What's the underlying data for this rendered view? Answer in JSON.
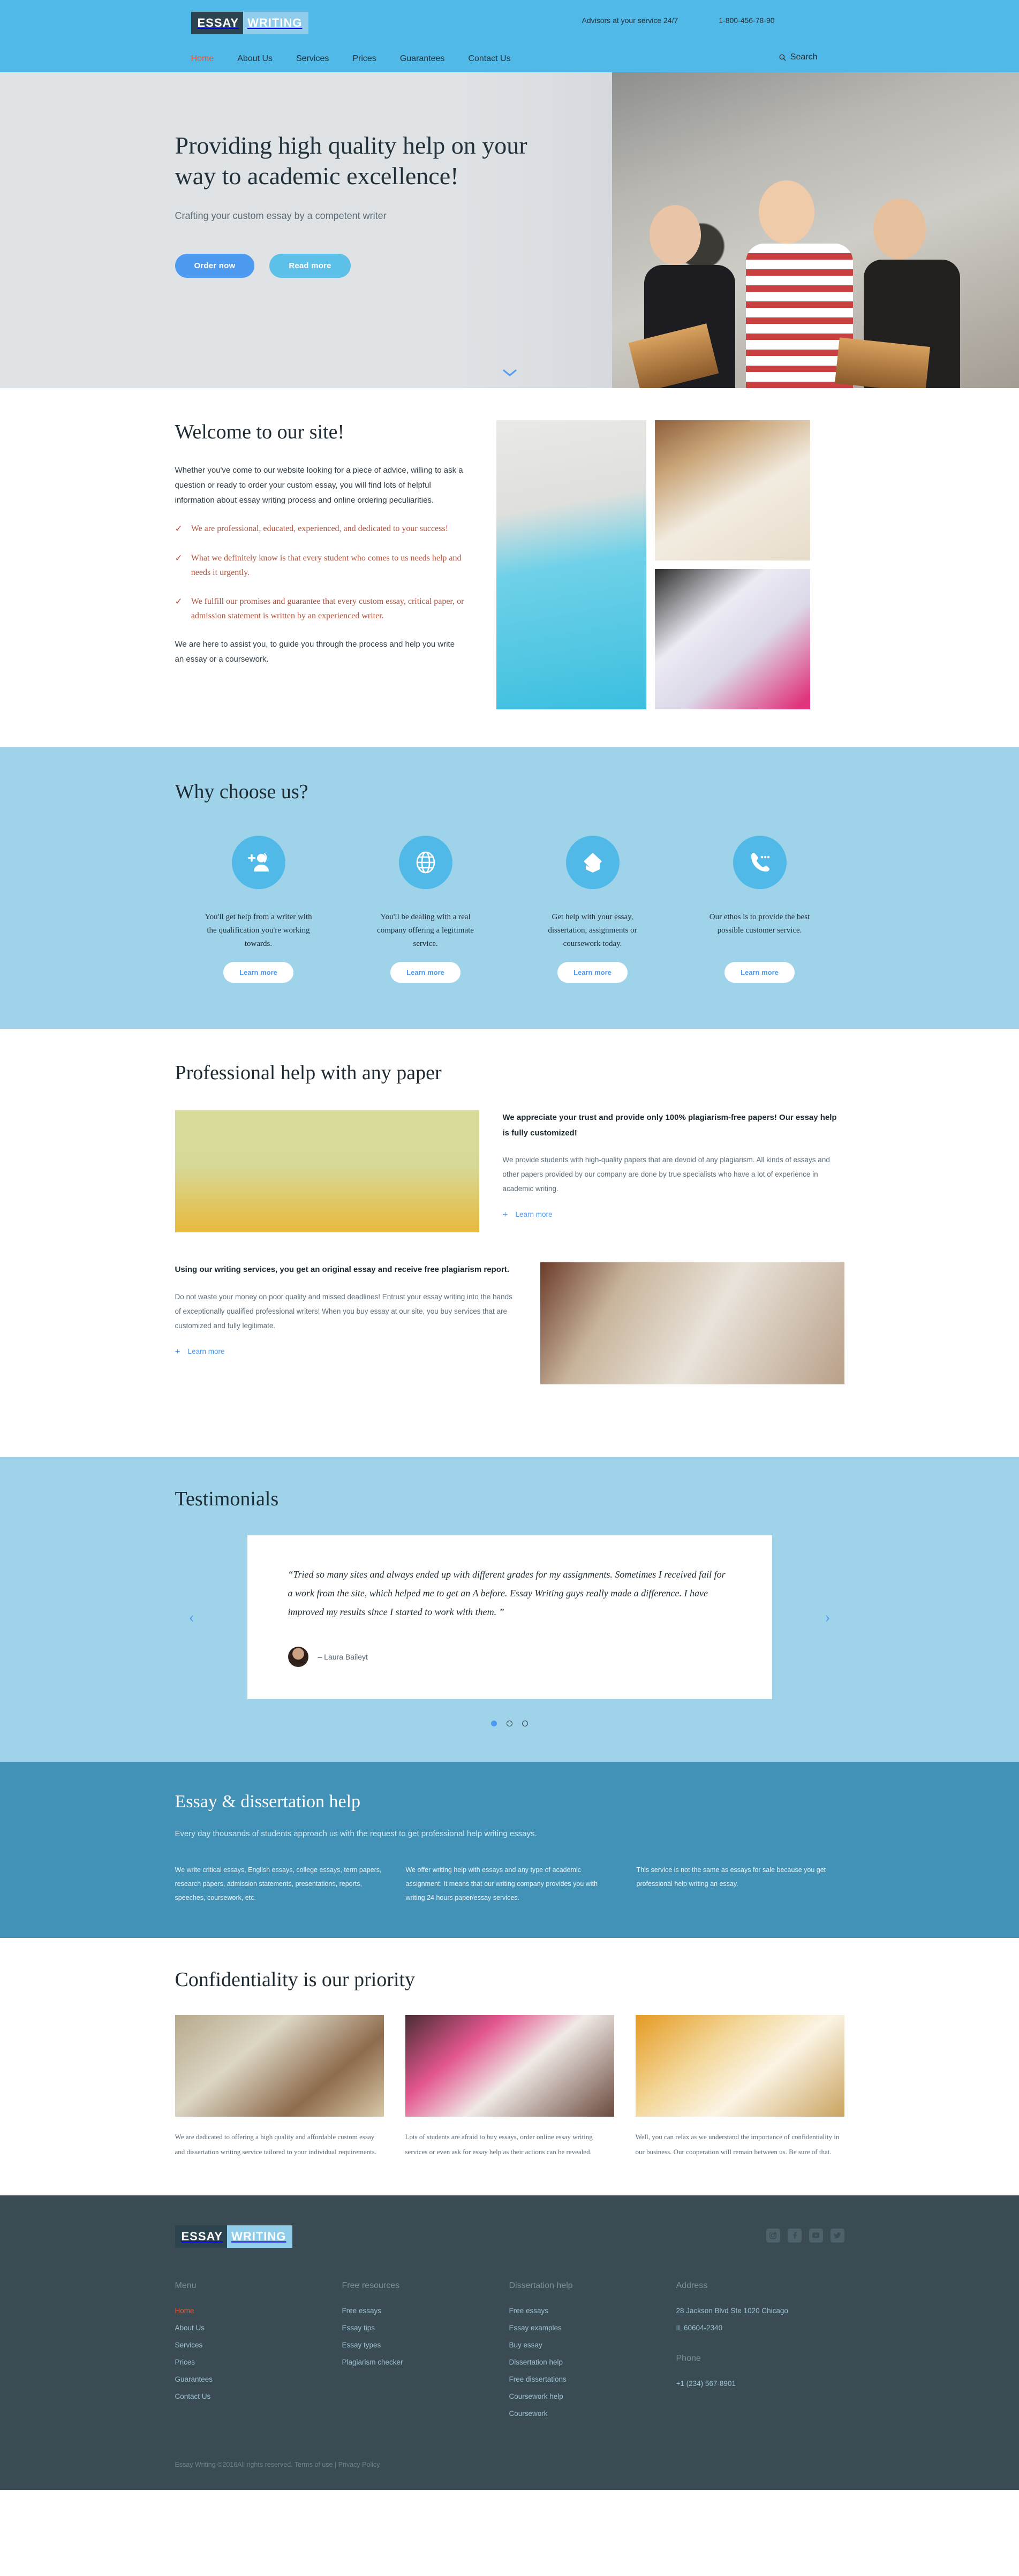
{
  "colors": {
    "header_blue": "#51b9e8",
    "light_blue": "#9fd3ea",
    "mid_blue": "#4292b8",
    "footer_dark": "#3a4b53",
    "accent_link": "#4d9bf0",
    "accent_red": "#e05a3f",
    "serif_red": "#b3503a"
  },
  "header": {
    "logo": {
      "part1": "ESSAY",
      "part2": "WRITING"
    },
    "contact": {
      "advisors": "Advisors at your service 24/7",
      "phone": "1-800-456-78-90"
    },
    "nav": [
      {
        "label": "Home",
        "active": true
      },
      {
        "label": "About Us",
        "active": false
      },
      {
        "label": "Services",
        "active": false
      },
      {
        "label": "Prices",
        "active": false
      },
      {
        "label": "Guarantees",
        "active": false
      },
      {
        "label": "Contact Us",
        "active": false
      }
    ],
    "search_label": "Search"
  },
  "hero": {
    "title": "Providing high quality help on your way to academic excellence!",
    "subtitle": "Crafting your custom essay by a competent writer",
    "btn_order": "Order now",
    "btn_read": "Read more"
  },
  "welcome": {
    "heading": "Welcome to our site!",
    "intro": "Whether you've come to our website looking for a piece of advice, willing to ask a question or ready to order your custom essay, you will find lots of helpful information about essay writing process and online ordering peculiarities.",
    "checks": [
      "We are professional, educated, experienced, and dedicated to your success!",
      "What we definitely know is that every student who comes to us needs help and needs it urgently.",
      "We fulfill our promises and guarantee that every custom essay, critical paper, or admission statement is written by an experienced writer."
    ],
    "outro": "We are here to assist you, to guide you through the process and help you write an essay or a coursework."
  },
  "why": {
    "heading": "Why choose us?",
    "items": [
      {
        "icon": "add-user-icon",
        "text": "You'll get help from a writer with the qualification you're working towards.",
        "button": "Learn more"
      },
      {
        "icon": "globe-icon",
        "text": "You'll be dealing with a real company offering a legitimate service.",
        "button": "Learn more"
      },
      {
        "icon": "graduation-cap-icon",
        "text": "Get help with your essay, dissertation, assignments or coursework today.",
        "button": "Learn more"
      },
      {
        "icon": "phone-icon",
        "text": "Our ethos is to provide the best possible customer service.",
        "button": "Learn more"
      }
    ]
  },
  "professional": {
    "heading": "Professional help with any paper",
    "blocks": [
      {
        "headline": "We appreciate your trust and provide only 100% plagiarism-free papers! Our essay help is fully customized!",
        "body": "We provide students with high-quality papers that are devoid of any plagiarism. All kinds of essays and other papers provided by our company are done by true specialists who have a lot of experience in academic writing.",
        "link": "Learn more"
      },
      {
        "headline": "Using our writing services, you get an original essay and receive free plagiarism report.",
        "body": "Do not waste your money on poor quality and missed deadlines! Entrust your essay writing into the hands of exceptionally qualified professional writers! When you buy essay at our site, you buy services that are customized and fully legitimate.",
        "link": "Learn more"
      }
    ]
  },
  "testimonials": {
    "heading": "Testimonials",
    "quote": "“Tried so many sites and always ended up with different grades for my assignments. Sometimes I received fail for a work from the site, which helped me to get an A before. Essay Writing guys really made a difference. I have improved my results since I started to work with them. ”",
    "author": "– Laura Baileyt",
    "prev": "‹",
    "next": "›",
    "dots": 3,
    "active_dot": 0
  },
  "dissertation": {
    "heading": "Essay & dissertation help",
    "lead": "Every day thousands of students approach us with the request to get professional help writing essays.",
    "columns": [
      "We write critical essays, English essays, college essays, term papers, research papers, admission statements, presentations, reports, speeches, coursework, etc.",
      "We offer writing help with essays and any type of academic assignment. It means that our writing company provides you with writing 24 hours paper/essay services.",
      "This service is not the same as essays for sale because you get professional help writing an essay."
    ]
  },
  "confidentiality": {
    "heading": "Confidentiality is our priority",
    "columns": [
      "We are dedicated to offering a high quality and affordable custom essay and dissertation writing service tailored to your individual requirements.",
      "Lots of students are afraid to buy essays, order online essay writing services or even ask for essay help as their actions can be revealed.",
      "Well, you can relax as we understand the importance of confidentiality in our business. Our cooperation will remain between us. Be sure of that."
    ]
  },
  "footer": {
    "logo": {
      "part1": "ESSAY",
      "part2": "WRITING"
    },
    "social": [
      {
        "name": "instagram-icon",
        "glyph": "▣"
      },
      {
        "name": "facebook-icon",
        "glyph": "f"
      },
      {
        "name": "youtube-icon",
        "glyph": "▶"
      },
      {
        "name": "twitter-icon",
        "glyph": "✐"
      }
    ],
    "columns": [
      {
        "title": "Menu",
        "links": [
          {
            "label": "Home",
            "active": true
          },
          {
            "label": "About Us",
            "active": false
          },
          {
            "label": "Services",
            "active": false
          },
          {
            "label": "Prices",
            "active": false
          },
          {
            "label": "Guarantees",
            "active": false
          },
          {
            "label": "Contact Us",
            "active": false
          }
        ]
      },
      {
        "title": "Free resources",
        "links": [
          {
            "label": "Free essays",
            "active": false
          },
          {
            "label": "Essay tips",
            "active": false
          },
          {
            "label": "Essay types",
            "active": false
          },
          {
            "label": "Plagiarism checker",
            "active": false
          }
        ]
      },
      {
        "title": "Dissertation help",
        "links": [
          {
            "label": "Free essays",
            "active": false
          },
          {
            "label": "Essay examples",
            "active": false
          },
          {
            "label": "Buy essay",
            "active": false
          },
          {
            "label": "Dissertation help",
            "active": false
          },
          {
            "label": "Free dissertations",
            "active": false
          },
          {
            "label": "Coursework help",
            "active": false
          },
          {
            "label": "Coursework",
            "active": false
          }
        ]
      }
    ],
    "address": {
      "title": "Address",
      "line1": "28 Jackson Blvd Ste 1020 Chicago",
      "line2": "IL 60604-2340",
      "phone_title": "Phone",
      "phone": "+1 (234) 567-8901"
    },
    "copyright": "Essay Writing ©2016All rights reserved.",
    "terms": "Terms of use",
    "separator": " | ",
    "privacy": "Privacy Policy"
  }
}
